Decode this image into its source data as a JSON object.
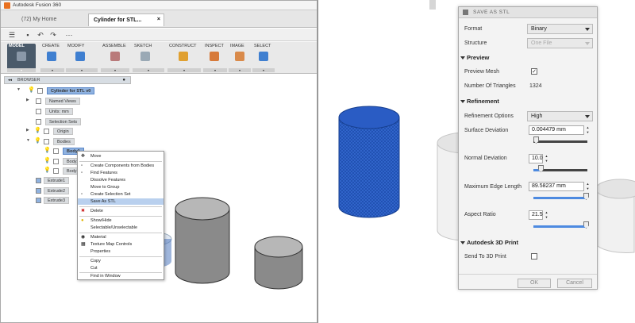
{
  "app": {
    "title": "Autodesk Fusion 360"
  },
  "tabs": [
    {
      "label": "(72) My Home"
    },
    {
      "label": "Cylinder for STL..."
    }
  ],
  "ribbon": {
    "groups": [
      {
        "label": "MODEL"
      },
      {
        "label": "CREATE"
      },
      {
        "label": "MODIFY"
      },
      {
        "label": "ASSEMBLE"
      },
      {
        "label": "SKETCH"
      },
      {
        "label": "CONSTRUCT"
      },
      {
        "label": "INSPECT"
      },
      {
        "label": "IMAGE"
      },
      {
        "label": "SELECT"
      }
    ]
  },
  "browser": {
    "title": "BROWSER",
    "root": "Cylinder for STL v0",
    "items": [
      "Named Views",
      "Units: mm",
      "Selection Sets",
      "Origin",
      "Bodies",
      "Body1",
      "Body2",
      "Body3",
      "Extrude1",
      "Extrude2",
      "Extrude3"
    ]
  },
  "context_menu": {
    "items": [
      "Move",
      "Create Components from Bodies",
      "Find Features",
      "Dissolve Features",
      "Move to Group",
      "Create Selection Set",
      "Save As STL",
      "Delete",
      "Show/Hide",
      "Selectable/Unselectable",
      "Material",
      "Texture Map Controls",
      "Properties",
      "Copy",
      "Cut",
      "Find in Window"
    ]
  },
  "dialog": {
    "title": "SAVE AS STL",
    "format_label": "Format",
    "format_value": "Binary",
    "structure_label": "Structure",
    "structure_value": "One File",
    "preview_section": "Preview",
    "preview_mesh_label": "Preview Mesh",
    "preview_mesh_checked": true,
    "preview_mesh_mark": "✓",
    "triangles_label": "Number Of Triangles",
    "triangles_value": "1324",
    "refinement_section": "Refinement",
    "refinement_options_label": "Refinement Options",
    "refinement_options_value": "High",
    "surface_deviation_label": "Surface Deviation",
    "surface_deviation_value": "0.004479 mm",
    "normal_deviation_label": "Normal Deviation",
    "normal_deviation_value": "10.0",
    "max_edge_label": "Maximum Edge Length",
    "max_edge_value": "89.58237 mm",
    "aspect_ratio_label": "Aspect Ratio",
    "aspect_ratio_value": "21.5",
    "print_section": "Autodesk 3D Print",
    "send_print_label": "Send To 3D Print",
    "send_print_checked": false,
    "ok_label": "OK",
    "cancel_label": "Cancel"
  },
  "colors": {
    "accent": "#1f4fb0",
    "highlight": "#b9d0ee",
    "selection": "#8fb2e0"
  }
}
